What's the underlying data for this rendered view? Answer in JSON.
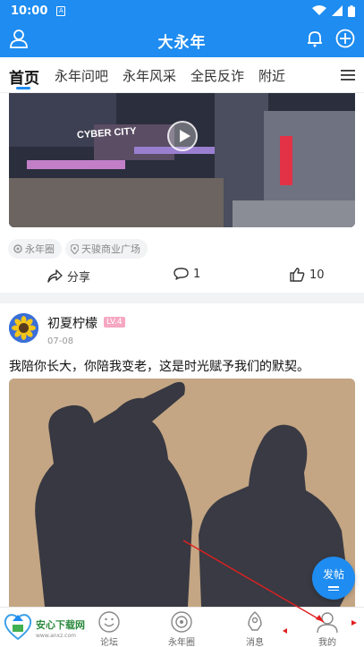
{
  "status": {
    "time": "10:00"
  },
  "header": {
    "title": "大永年"
  },
  "tabs": [
    {
      "label": "首页"
    },
    {
      "label": "永年问吧"
    },
    {
      "label": "永年风采"
    },
    {
      "label": "全民反诈"
    },
    {
      "label": "附近"
    }
  ],
  "post1": {
    "video_overlay_text": "CYBER CITY",
    "tags": [
      {
        "label": "永年圈"
      },
      {
        "label": "天骏商业广场"
      }
    ],
    "share_label": "分享",
    "comment_count": "1",
    "like_count": "10"
  },
  "post2": {
    "username": "初夏柠檬",
    "level": "LV.4",
    "date": "07-08",
    "text": "我陪你长大，你陪我变老，这是时光赋予我们的默契。"
  },
  "fab": {
    "label": "发帖"
  },
  "bottom_nav": [
    {
      "label": "论坛"
    },
    {
      "label": "永年圈"
    },
    {
      "label": "消息"
    },
    {
      "label": "我的"
    }
  ],
  "watermark": {
    "brand": "安心下载网",
    "url": "www.anxz.com"
  },
  "colors": {
    "primary": "#1e8cf0",
    "level_badge": "#f6a7c1"
  }
}
